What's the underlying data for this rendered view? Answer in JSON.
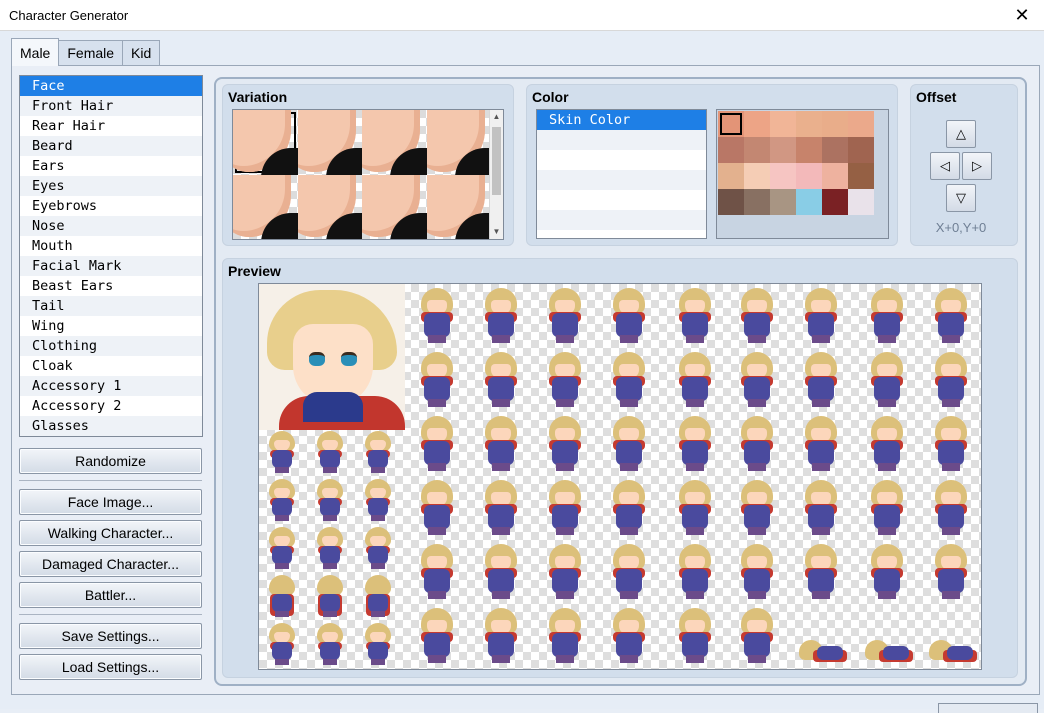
{
  "window": {
    "title": "Character Generator",
    "close_glyph": "✕"
  },
  "tabs": [
    {
      "label": "Male",
      "active": true
    },
    {
      "label": "Female",
      "active": false
    },
    {
      "label": "Kid",
      "active": false
    }
  ],
  "parts": {
    "selected": "Face",
    "items": [
      "Face",
      "Front Hair",
      "Rear Hair",
      "Beard",
      "Ears",
      "Eyes",
      "Eyebrows",
      "Nose",
      "Mouth",
      "Facial Mark",
      "Beast Ears",
      "Tail",
      "Wing",
      "Clothing",
      "Cloak",
      "Accessory 1",
      "Accessory 2",
      "Glasses"
    ]
  },
  "buttons": {
    "randomize": "Randomize",
    "face_image": "Face Image...",
    "walking_character": "Walking Character...",
    "damaged_character": "Damaged Character...",
    "battler": "Battler...",
    "save_settings": "Save Settings...",
    "load_settings": "Load Settings..."
  },
  "variation": {
    "title": "Variation",
    "selected_index": 0,
    "thumbnail_count": 8
  },
  "color": {
    "title": "Color",
    "items": [
      "Skin Color",
      "",
      "",
      "",
      "",
      ""
    ],
    "selected": "Skin Color",
    "palette": [
      "#e39477",
      "#eda486",
      "#f1b597",
      "#eab08d",
      "#e9ad8a",
      "#eba98b",
      "#b97766",
      "#c38772",
      "#d19783",
      "#c7836b",
      "#ac7261",
      "#a06450",
      "#e3b18e",
      "#f5cdb5",
      "#f6c5c2",
      "#f3b9ba",
      "#eeb29f",
      "#956044",
      "#6f5247",
      "#887062",
      "#a89583",
      "#89cde6",
      "#7a2124",
      "#e9e2ea"
    ],
    "palette_selected_index": 0
  },
  "offset": {
    "title": "Offset",
    "up_icon": "△",
    "left_icon": "◁",
    "right_icon": "▷",
    "down_icon": "▽",
    "value_text": "X+0,Y+0"
  },
  "preview": {
    "title": "Preview"
  },
  "scroll": {
    "up_icon": "▲",
    "down_icon": "▼"
  }
}
